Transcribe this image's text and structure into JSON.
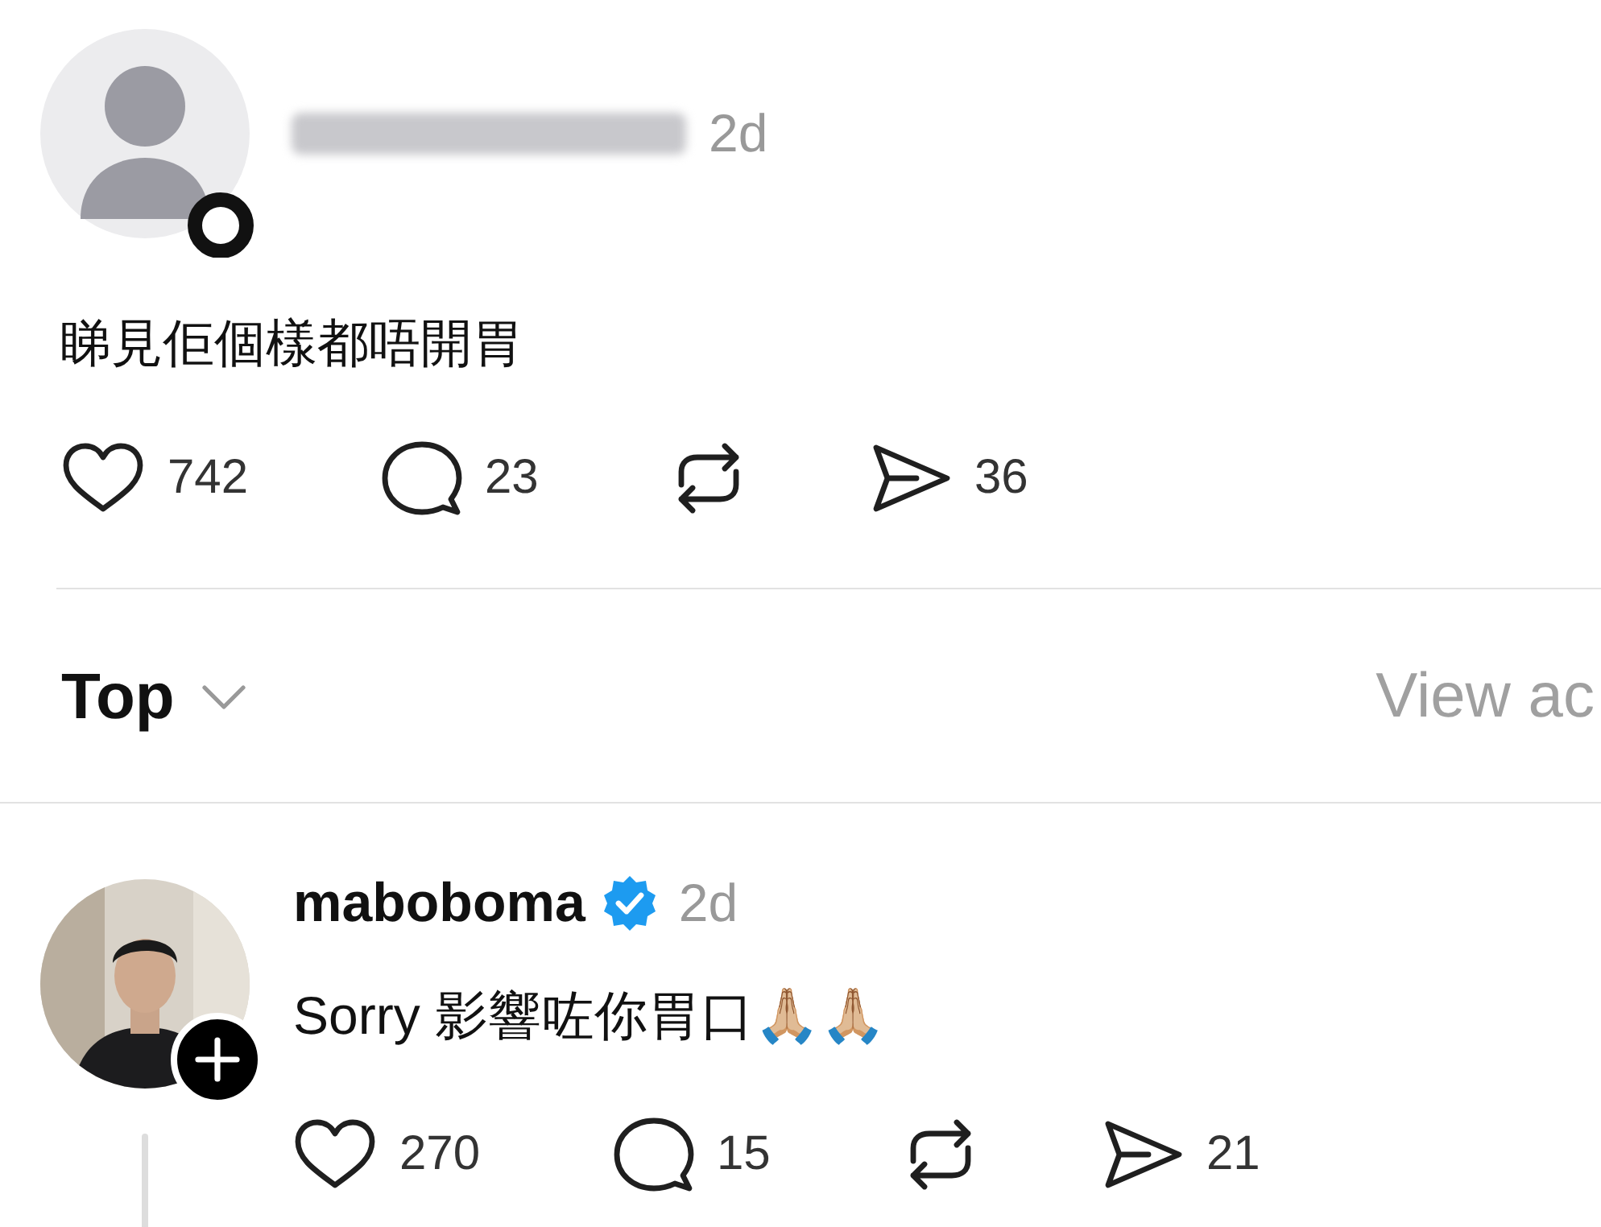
{
  "post": {
    "time": "2d",
    "text": "睇見佢個樣都唔開胃",
    "actions": [
      {
        "kind": "like",
        "count": "742"
      },
      {
        "kind": "comment",
        "count": "23"
      },
      {
        "kind": "repost"
      },
      {
        "kind": "share",
        "count": "36"
      }
    ]
  },
  "sort": {
    "label": "Top",
    "link": "View ac"
  },
  "replies": [
    {
      "username": "maboboma",
      "verified": true,
      "time": "2d",
      "text": "Sorry 影響咗你胃口🙏🏼🙏🏼",
      "actions": [
        {
          "kind": "like",
          "count": "270"
        },
        {
          "kind": "comment",
          "count": "15"
        },
        {
          "kind": "repost"
        },
        {
          "kind": "share",
          "count": "21"
        }
      ]
    }
  ]
}
